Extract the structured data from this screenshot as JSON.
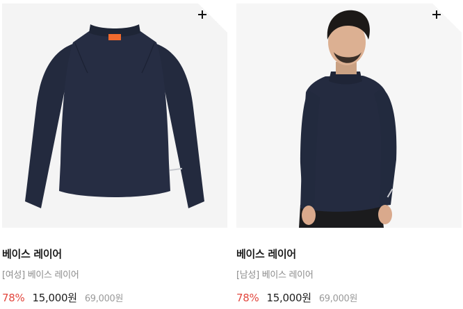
{
  "products": [
    {
      "name": "베이스 레이어",
      "subtitle": "[여성] 베이스 레이어",
      "discount": "78%",
      "price": "15,000원",
      "original_price": "69,000원",
      "image_icon": "shirt-icon"
    },
    {
      "name": "베이스 레이어",
      "subtitle": "[남성] 베이스 레이어",
      "discount": "78%",
      "price": "15,000원",
      "original_price": "69,000원",
      "image_icon": "model-photo"
    }
  ],
  "colors": {
    "discount": "#e2473e",
    "price": "#1d1d1d",
    "subtitle": "#8c8c8c",
    "original_price": "#9a9a9a",
    "garment": "#252b40"
  }
}
